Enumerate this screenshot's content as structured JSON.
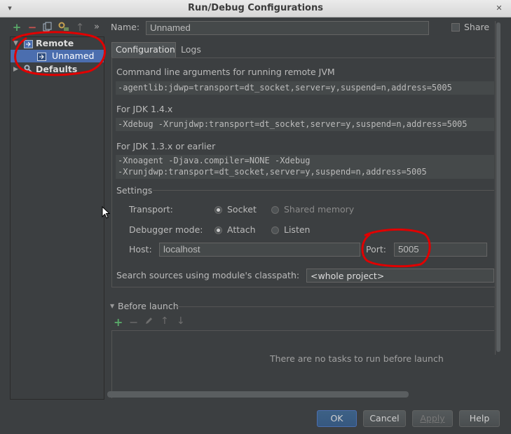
{
  "window": {
    "title": "Run/Debug Configurations"
  },
  "toolbar": {
    "add_icon": "+",
    "remove_icon": "−",
    "more_icon": "»"
  },
  "tree": {
    "remote_label": "Remote",
    "unnamed_label": "Unnamed",
    "defaults_label": "Defaults"
  },
  "header": {
    "name_label": "Name:",
    "name_value": "Unnamed",
    "share_label": "Share",
    "share_checked": false
  },
  "tabs": [
    {
      "label": "Configuration",
      "active": true
    },
    {
      "label": "Logs",
      "active": false
    }
  ],
  "config": {
    "jvm_heading": "Command line arguments for running remote JVM",
    "jvm_args": "-agentlib:jdwp=transport=dt_socket,server=y,suspend=n,address=5005",
    "jdk14_heading": "For JDK 1.4.x",
    "jdk14_args": "-Xdebug -Xrunjdwp:transport=dt_socket,server=y,suspend=n,address=5005",
    "jdk13_heading": "For JDK 1.3.x or earlier",
    "jdk13_args_line1": "-Xnoagent -Djava.compiler=NONE -Xdebug",
    "jdk13_args_line2": "-Xrunjdwp:transport=dt_socket,server=y,suspend=n,address=5005"
  },
  "settings": {
    "heading": "Settings",
    "transport_label": "Transport:",
    "transport_options": [
      "Socket",
      "Shared memory"
    ],
    "transport_selected": "Socket",
    "debugger_label": "Debugger mode:",
    "debugger_options": [
      "Attach",
      "Listen"
    ],
    "debugger_selected": "Attach",
    "host_label": "Host:",
    "host_value": "localhost",
    "port_label": "Port:",
    "port_value": "5005",
    "classpath_label": "Search sources using module's classpath:",
    "classpath_value": "<whole project>"
  },
  "before_launch": {
    "heading": "Before launch",
    "empty_text": "There are no tasks to run before launch"
  },
  "buttons": {
    "ok": "OK",
    "cancel": "Cancel",
    "apply": "Apply",
    "help": "Help"
  },
  "colors": {
    "background": "#3c3f41",
    "selection": "#4b6eaf",
    "annotation_red": "#e00000",
    "add_green": "#59a869",
    "remove_red": "#c75450"
  }
}
